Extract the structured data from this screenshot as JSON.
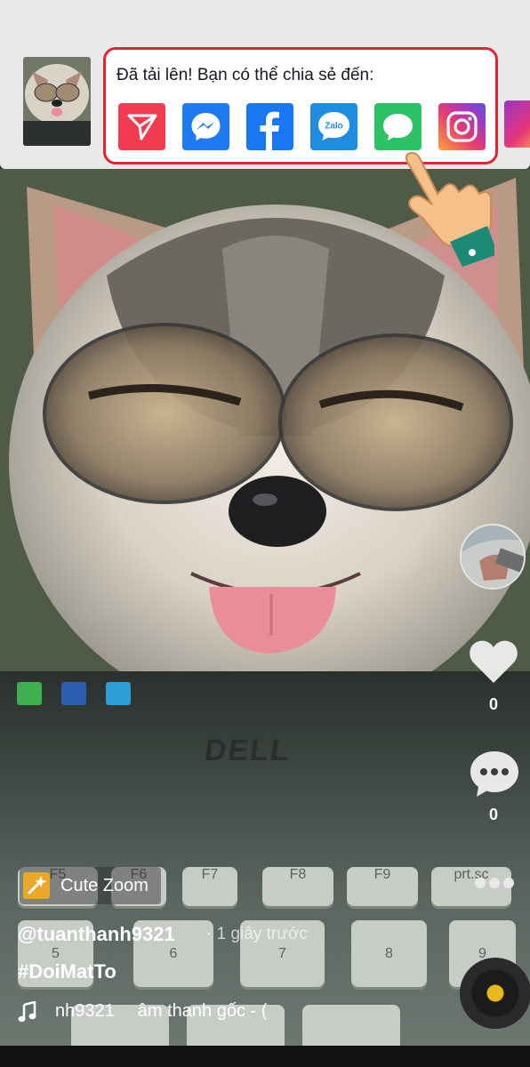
{
  "share": {
    "title": "Đã tải lên! Bạn có thể chia sẻ đến:",
    "targets": [
      {
        "name": "direct",
        "icon": "paper-plane-icon",
        "color": "#f23b50"
      },
      {
        "name": "messenger",
        "icon": "messenger-icon",
        "color": "#1f7bf2"
      },
      {
        "name": "facebook",
        "icon": "facebook-icon",
        "color": "#1877f2"
      },
      {
        "name": "zalo",
        "icon": "zalo-icon",
        "color": "#1e8de0",
        "label": "Zalo"
      },
      {
        "name": "message",
        "icon": "chat-bubble-icon",
        "color": "#2ec267"
      },
      {
        "name": "instagram",
        "icon": "instagram-icon",
        "color": "#c837ab"
      }
    ]
  },
  "laptop": {
    "brand": "DELL",
    "keys": [
      "F5",
      "F6",
      "F7",
      "F8",
      "F9",
      "prt.sc",
      "5",
      "6",
      "7",
      "8",
      "9",
      "^",
      "&",
      "*"
    ]
  },
  "rail": {
    "likes": "0",
    "comments": "0"
  },
  "caption": {
    "effect": "Cute Zoom",
    "username": "@tuanthanh9321",
    "time": "· 1 giây trước",
    "hashtag": "#DoiMatTo",
    "music_user": "nh9321",
    "music_title": "âm thanh gốc - ("
  }
}
